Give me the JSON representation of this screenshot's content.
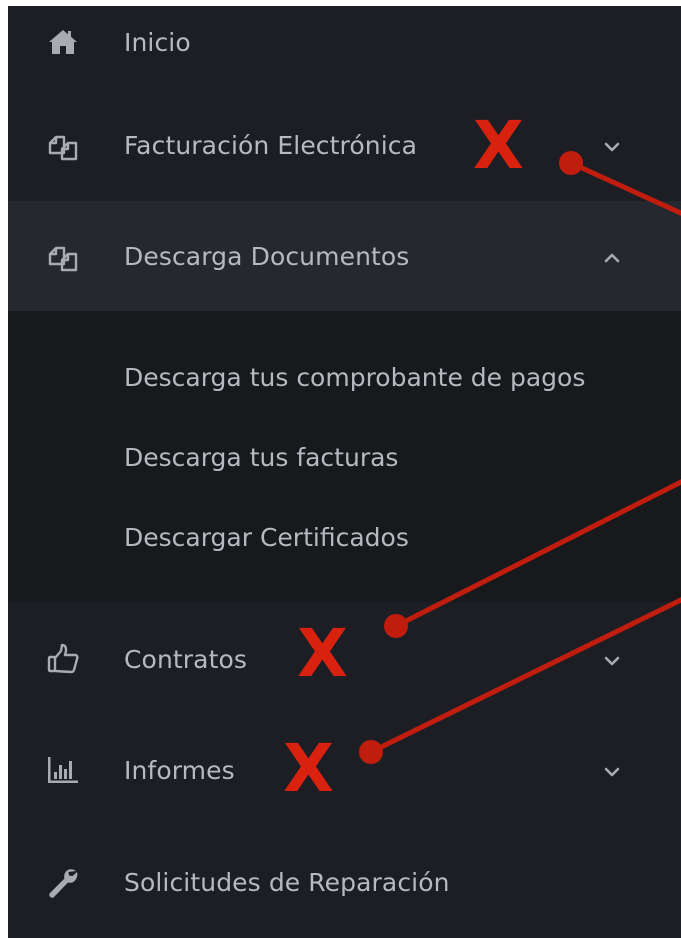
{
  "sidebar": {
    "items": [
      {
        "label": "Inicio",
        "icon": "home-icon"
      },
      {
        "label": "Facturación Electrónica",
        "icon": "documents-icon",
        "chevron": "chevron-down-icon"
      },
      {
        "label": "Descarga Documentos",
        "icon": "documents-icon",
        "chevron": "chevron-up-icon",
        "expanded": true
      },
      {
        "label": "Contratos",
        "icon": "thumbs-up-icon",
        "chevron": "chevron-down-icon"
      },
      {
        "label": "Informes",
        "icon": "bar-chart-icon",
        "chevron": "chevron-down-icon"
      },
      {
        "label": "Solicitudes de Reparación",
        "icon": "wrench-icon"
      }
    ],
    "submenu": [
      {
        "label": "Descarga tus comprobante de pagos"
      },
      {
        "label": "Descarga tus facturas"
      },
      {
        "label": "Descargar Certificados"
      }
    ]
  },
  "annotations": {
    "marks": [
      "X",
      "X",
      "X"
    ],
    "color": "#d8220f"
  },
  "colors": {
    "sidebar_bg": "#1d1e24",
    "active_bg": "#262830",
    "submenu_bg": "#18191d",
    "text": "#b6b9bf"
  }
}
